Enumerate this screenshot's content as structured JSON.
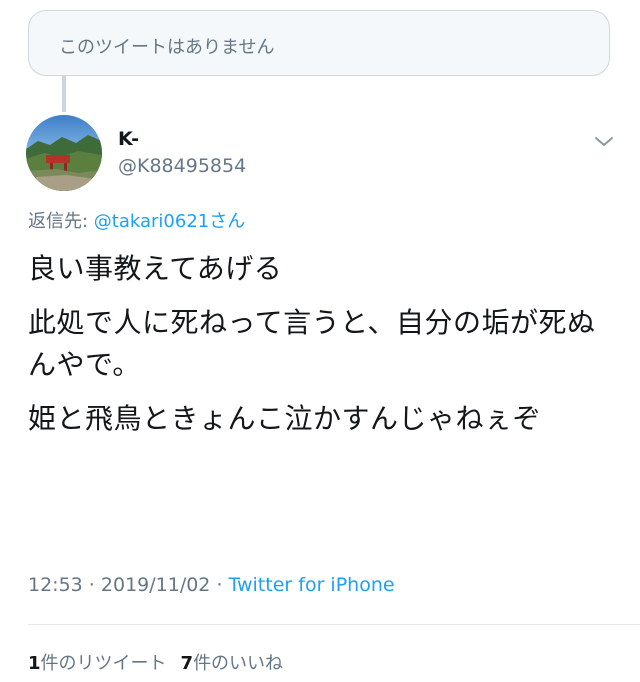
{
  "quoted_unavailable": {
    "text": "このツイートはありません"
  },
  "author": {
    "display_name": "K-",
    "handle": "@K88495854"
  },
  "reply": {
    "prefix": "返信先: ",
    "mention": "@takari0621さん"
  },
  "tweet": {
    "line1": "良い事教えてあげる",
    "line2": "此処で人に死ねって言うと、自分の垢が死ぬんやで。",
    "line3": "姫と飛鳥ときょんこ泣かすんじゃねぇぞ"
  },
  "meta": {
    "time": "12:53",
    "sep": " · ",
    "date": "2019/11/02",
    "sep2": " · ",
    "source": "Twitter for iPhone"
  },
  "stats": {
    "retweets_count": "1",
    "retweets_label": "件のリツイート",
    "likes_count": "7",
    "likes_label": "件のいいね"
  },
  "icons": {
    "menu": "chevron-down-icon",
    "avatar": "profile-avatar"
  }
}
